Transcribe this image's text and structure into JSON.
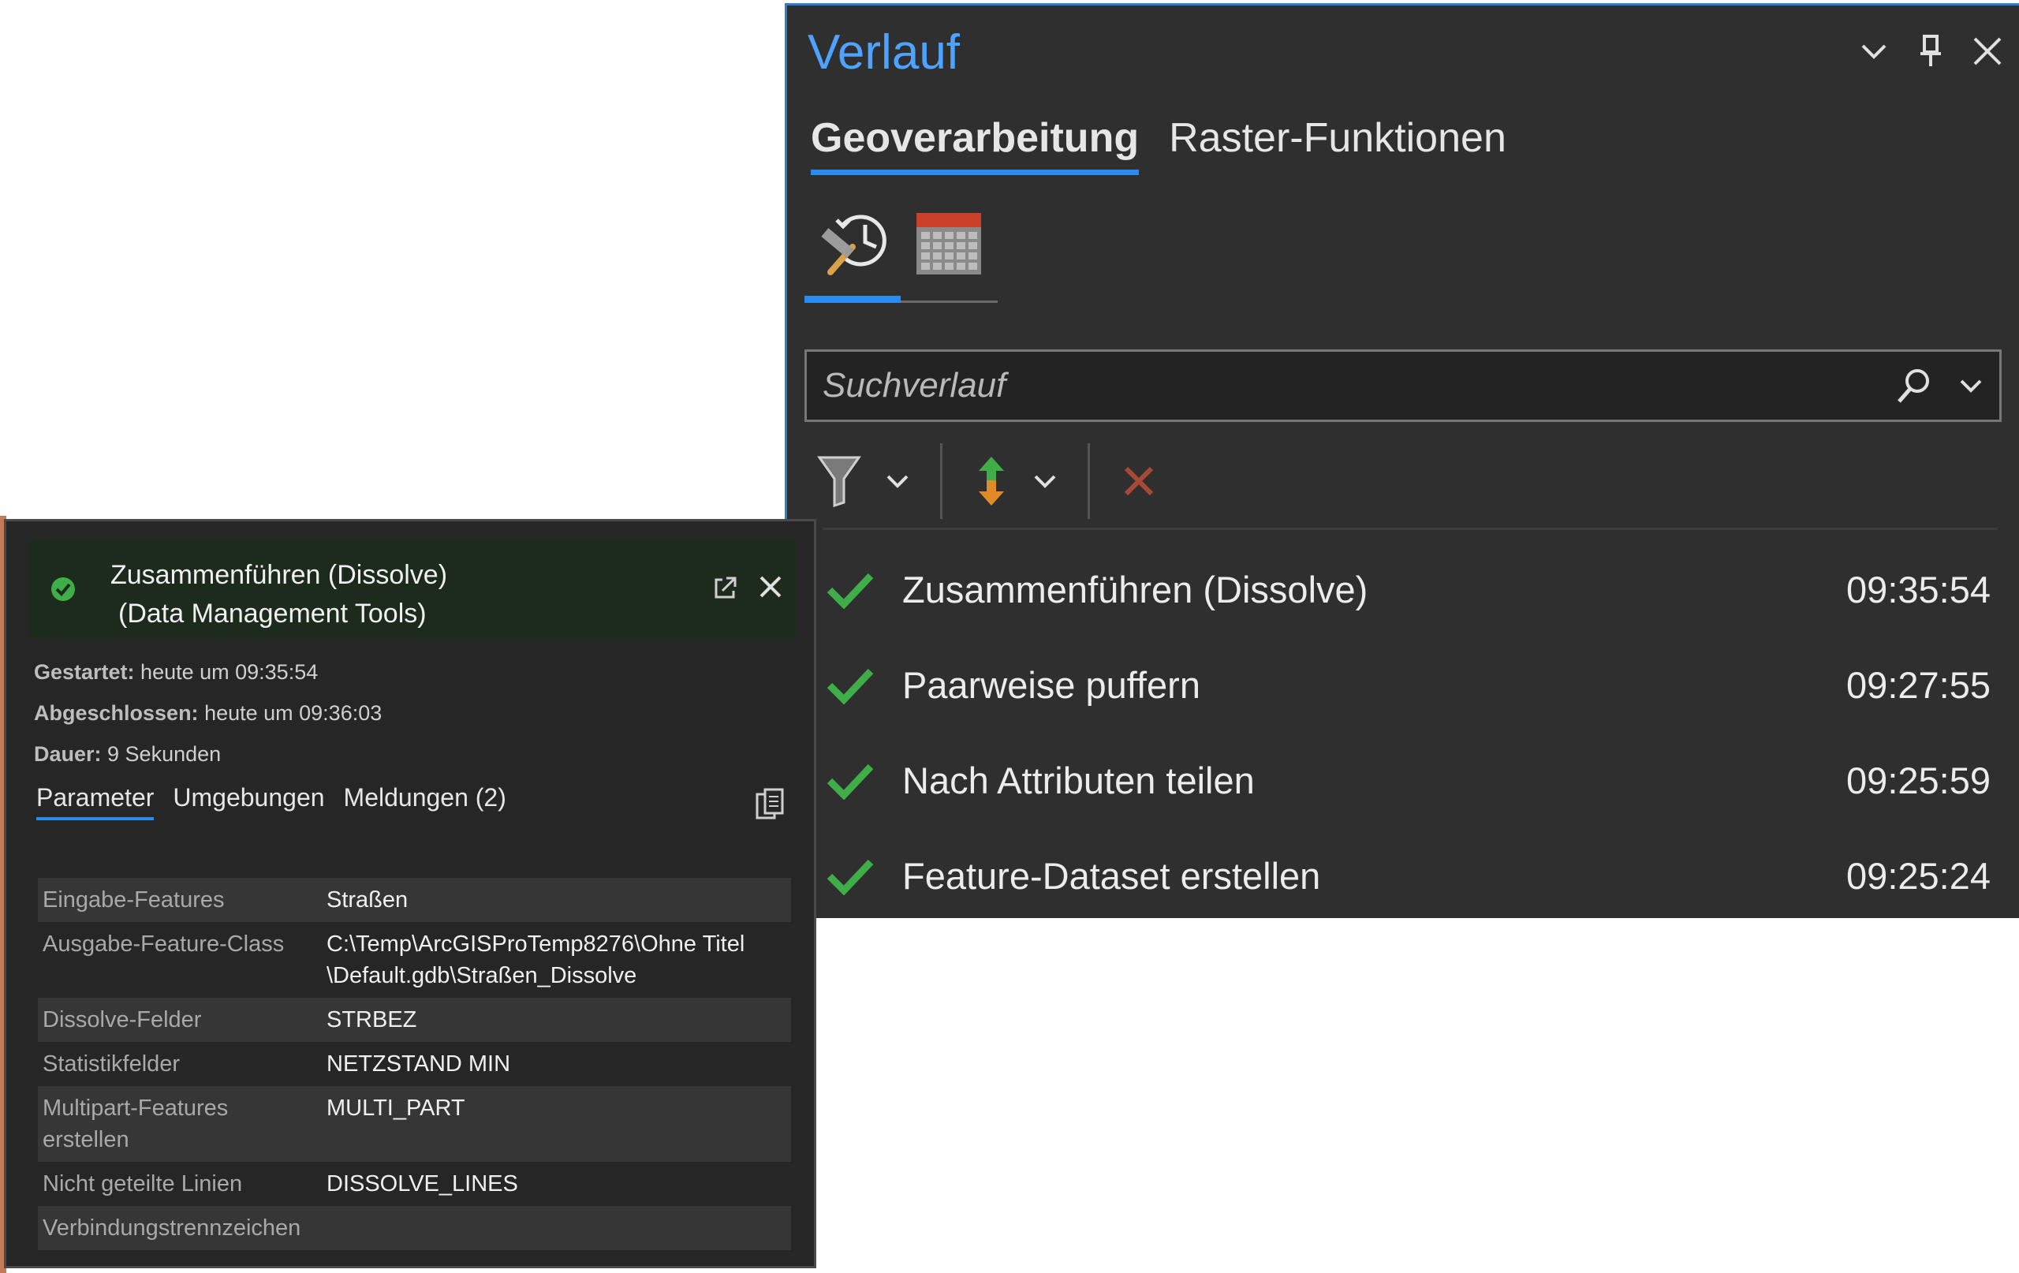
{
  "history": {
    "title": "Verlauf",
    "controls": {
      "menu_icon": "chevron-down-icon",
      "pin_icon": "pin-icon",
      "close_icon": "close-icon"
    },
    "tabs": [
      {
        "label": "Geoverarbeitung",
        "active": true
      },
      {
        "label": "Raster-Funktionen",
        "active": false
      }
    ],
    "views": [
      {
        "icon": "history-tool-icon",
        "active": true
      },
      {
        "icon": "calendar-icon",
        "active": false
      }
    ],
    "search": {
      "placeholder": "Suchverlauf",
      "value": ""
    },
    "toolbar": {
      "filter_icon": "filter-icon",
      "sort_icon": "sort-icon",
      "delete_icon": "delete-icon"
    },
    "items": [
      {
        "name": "Zusammenführen (Dissolve)",
        "time": "09:35:54",
        "status": "success"
      },
      {
        "name": "Paarweise puffern",
        "time": "09:27:55",
        "status": "success"
      },
      {
        "name": "Nach Attributen teilen",
        "time": "09:25:59",
        "status": "success"
      },
      {
        "name": "Feature-Dataset erstellen",
        "time": "09:25:24",
        "status": "success"
      }
    ]
  },
  "details": {
    "title_line1": "Zusammenführen (Dissolve)",
    "title_line2": "(Data Management Tools)",
    "meta": {
      "started_label": "Gestartet:",
      "started_value": " heute um 09:35:54",
      "finished_label": "Abgeschlossen:",
      "finished_value": " heute um 09:36:03",
      "duration_label": "Dauer:",
      "duration_value": " 9 Sekunden"
    },
    "tabs": [
      {
        "label": "Parameter",
        "active": true
      },
      {
        "label": "Umgebungen",
        "active": false
      },
      {
        "label": "Meldungen (2)",
        "active": false
      }
    ],
    "parameters": [
      {
        "name": "Eingabe-Features",
        "value": "Straßen"
      },
      {
        "name": "Ausgabe-Feature-Class",
        "value": "C:\\Temp\\ArcGISProTemp8276\\Ohne Titel\n\\Default.gdb\\Straßen_Dissolve"
      },
      {
        "name": "Dissolve-Felder",
        "value": "STRBEZ"
      },
      {
        "name": "Statistikfelder",
        "value": "NETZSTAND MIN"
      },
      {
        "name": "Multipart-Features\nerstellen",
        "value": "MULTI_PART"
      },
      {
        "name": "Nicht geteilte Linien",
        "value": "DISSOLVE_LINES"
      },
      {
        "name": "Verbindungstrennzeichen",
        "value": ""
      }
    ]
  },
  "colors": {
    "accent": "#2b8cf0",
    "title": "#4da3ff",
    "success": "#3fae49",
    "pane_bg": "#2f2f2f"
  }
}
